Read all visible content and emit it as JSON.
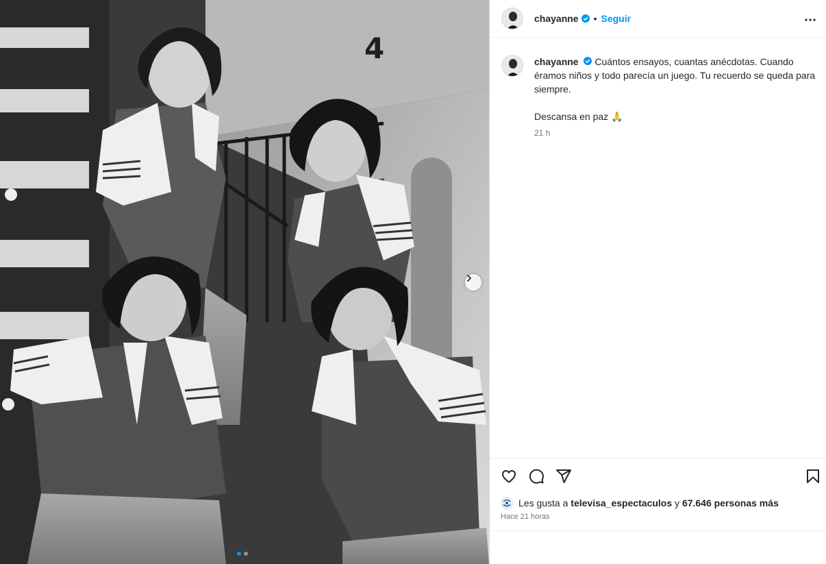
{
  "photo": {
    "alt_shape": "black-and-white photo of four boys in striped-sleeve shirts posing on a spiral staircase",
    "wall_number": "4",
    "slide_count": 2,
    "active_slide": 1,
    "next_icon": "chevron-right-icon"
  },
  "header": {
    "username": "chayanne",
    "separator": "•",
    "follow_label": "Seguir",
    "verified_icon": "verified-badge-icon",
    "more_icon": "more-horizontal-icon"
  },
  "caption": {
    "username": "chayanne",
    "text": "Cuántos ensayos, cuantas anécdotas. Cuando éramos niños y todo parecía un juego. Tu recuerdo se queda para siempre.",
    "extra": "Descansa en paz 🙏",
    "time": "21 h"
  },
  "actions": {
    "like_icon": "heart-icon",
    "comment_icon": "comment-icon",
    "share_icon": "share-icon",
    "save_icon": "bookmark-icon"
  },
  "likes": {
    "prefix": "Les gusta a ",
    "first_user": "televisa_espectaculos",
    "connector": " y ",
    "others": "67.646 personas más"
  },
  "posted": "Hace 21 horas",
  "colors": {
    "accent": "#0095f6",
    "text": "#262626",
    "muted": "#737373"
  }
}
